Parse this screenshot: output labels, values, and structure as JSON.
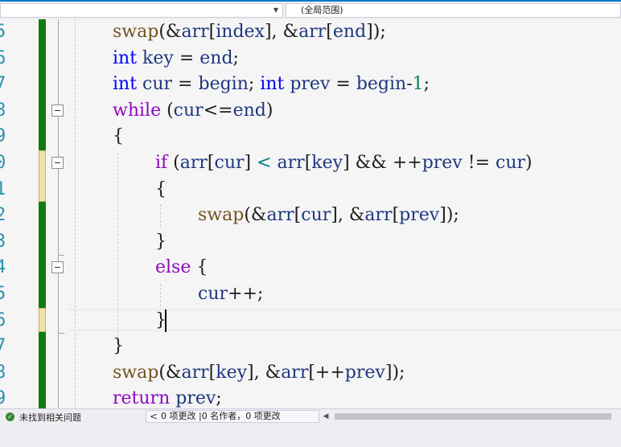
{
  "navbar": {
    "left_dropdown_value": "",
    "scope_label": "(全局范围)"
  },
  "editor": {
    "line_numbers": [
      "5",
      "6",
      "7",
      "8",
      "9",
      "0",
      "1",
      "2",
      "3",
      "4",
      "5",
      "6",
      "7",
      "8",
      "9"
    ],
    "lines": [
      "swap(&arr[index], &arr[end]);",
      "int key = end;",
      "int cur = begin; int prev = begin-1;",
      "while (cur<=end)",
      "{",
      "if (arr[cur] < arr[key] && ++prev != cur)",
      "{",
      "swap(&arr[cur], &arr[prev]);",
      "}",
      "else {",
      "cur++;",
      "}",
      "}",
      "swap(&arr[key], &arr[++prev]);",
      "return prev;"
    ]
  },
  "colors": {
    "saved_change": "#107c10",
    "unsaved_change": "#efe2ac",
    "accent": "#007acc"
  },
  "status": {
    "issues_text": "未找到相关问题",
    "changes_text": "0 项更改 |0 名作者，0 项更改"
  }
}
